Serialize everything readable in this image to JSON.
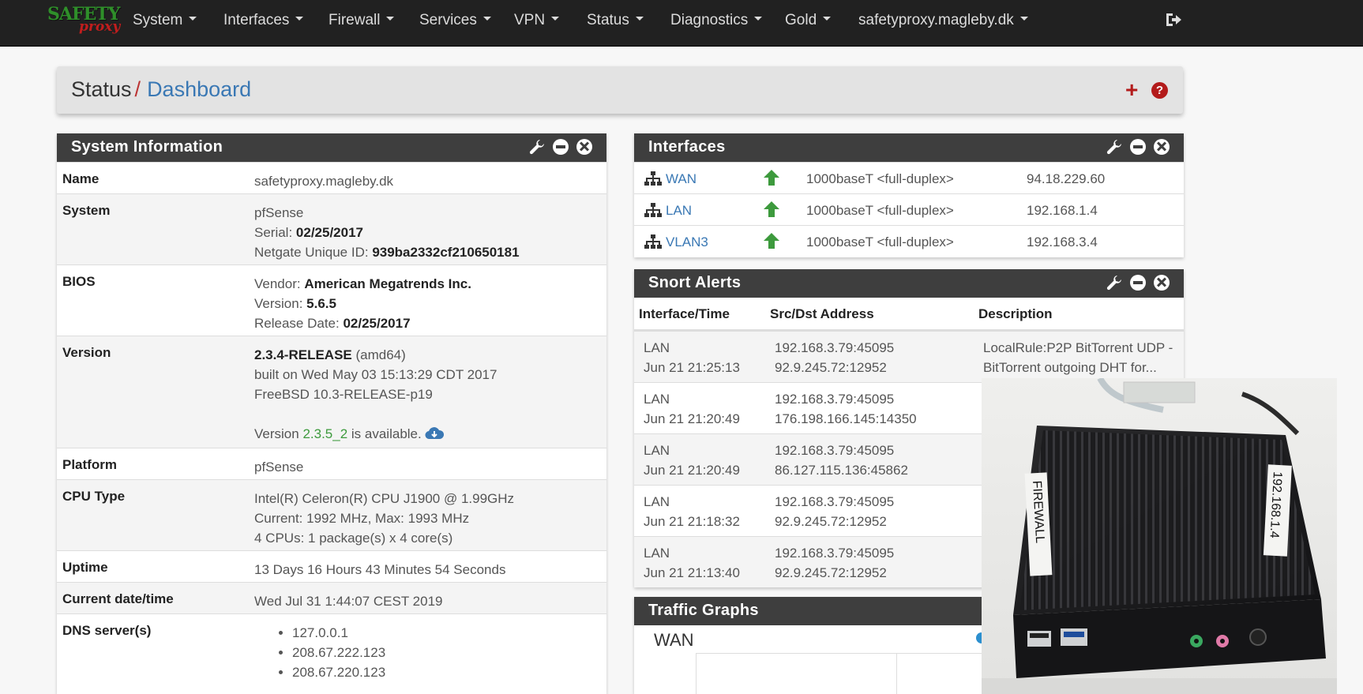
{
  "navbar": {
    "logo_top": "SAFETY",
    "logo_bottom": "proxy",
    "items": [
      {
        "label": "System"
      },
      {
        "label": "Interfaces"
      },
      {
        "label": "Firewall"
      },
      {
        "label": "Services"
      },
      {
        "label": "VPN"
      },
      {
        "label": "Status"
      },
      {
        "label": "Diagnostics"
      },
      {
        "label": "Gold"
      },
      {
        "label": "safetyproxy.magleby.dk"
      }
    ],
    "logout_icon": "sign-out-icon"
  },
  "breadcrumb": {
    "section": "Status",
    "separator": "/",
    "page": "Dashboard",
    "add_icon": "plus-icon",
    "help_icon": "question-circle-icon"
  },
  "system_info": {
    "title": "System Information",
    "rows": {
      "name": {
        "key": "Name",
        "value": "safetyproxy.magleby.dk"
      },
      "system": {
        "key": "System",
        "line1": "pfSense",
        "serial_label": "Serial: ",
        "serial": "02/25/2017",
        "netgate_label": "Netgate Unique ID: ",
        "netgate_id": "939ba2332cf210650181"
      },
      "bios": {
        "key": "BIOS",
        "vendor_label": "Vendor: ",
        "vendor": "American Megatrends Inc.",
        "version_label": "Version: ",
        "version": "5.6.5",
        "release_label": "Release Date: ",
        "release": "02/25/2017"
      },
      "version": {
        "key": "Version",
        "release": "2.3.4-RELEASE",
        "arch": " (amd64)",
        "built": "built on Wed May 03 15:13:29 CDT 2017",
        "freebsd": "FreeBSD 10.3-RELEASE-p19",
        "avail_pre": "Version ",
        "avail_ver": "2.3.5_2",
        "avail_post": " is available."
      },
      "platform": {
        "key": "Platform",
        "value": "pfSense"
      },
      "cpu": {
        "key": "CPU Type",
        "line1": "Intel(R) Celeron(R) CPU J1900 @ 1.99GHz",
        "line2": "Current: 1992 MHz, Max: 1993 MHz",
        "line3": "4 CPUs: 1 package(s) x 4 core(s)"
      },
      "uptime": {
        "key": "Uptime",
        "value": "13 Days 16 Hours 43 Minutes 54 Seconds"
      },
      "datetime": {
        "key": "Current date/time",
        "value": "Wed Jul 31 1:44:07 CEST 2019"
      },
      "dns": {
        "key": "DNS server(s)",
        "servers": [
          "127.0.0.1",
          "208.67.222.123",
          "208.67.220.123"
        ]
      }
    }
  },
  "interfaces": {
    "title": "Interfaces",
    "rows": [
      {
        "name": "WAN",
        "media": "1000baseT <full-duplex>",
        "ip": "94.18.229.60"
      },
      {
        "name": "LAN",
        "media": "1000baseT <full-duplex>",
        "ip": "192.168.1.4"
      },
      {
        "name": "VLAN3",
        "media": "1000baseT <full-duplex>",
        "ip": "192.168.3.4"
      }
    ]
  },
  "snort": {
    "title": "Snort Alerts",
    "headers": [
      "Interface/Time",
      "Src/Dst Address",
      "Description"
    ],
    "rows": [
      {
        "iface": "LAN",
        "time": "Jun 21 21:25:13",
        "src": "192.168.3.79:45095",
        "dst": "92.9.245.72:12952",
        "desc1": "LocalRule:P2P BitTorrent UDP -",
        "desc2": "BitTorrent outgoing DHT for..."
      },
      {
        "iface": "LAN",
        "time": "Jun 21 21:20:49",
        "src": "192.168.3.79:45095",
        "dst": "176.198.166.145:14350",
        "desc1": "",
        "desc2": ""
      },
      {
        "iface": "LAN",
        "time": "Jun 21 21:20:49",
        "src": "192.168.3.79:45095",
        "dst": "86.127.115.136:45862",
        "desc1": "",
        "desc2": ""
      },
      {
        "iface": "LAN",
        "time": "Jun 21 21:18:32",
        "src": "192.168.3.79:45095",
        "dst": "92.9.245.72:12952",
        "desc1": "",
        "desc2": ""
      },
      {
        "iface": "LAN",
        "time": "Jun 21 21:13:40",
        "src": "192.168.3.79:45095",
        "dst": "92.9.245.72:12952",
        "desc1": "",
        "desc2": ""
      }
    ]
  },
  "traffic": {
    "title": "Traffic Graphs",
    "series_label": "WAN"
  },
  "photo": {
    "label_left": "FIREWALL",
    "label_right": "192.168.1.4"
  },
  "colors": {
    "navbar": "#212121",
    "panel_heading": "#3e3e3e",
    "link": "#3a78b4",
    "accent_red": "#b31b1b",
    "status_up": "#3d9a3d"
  }
}
